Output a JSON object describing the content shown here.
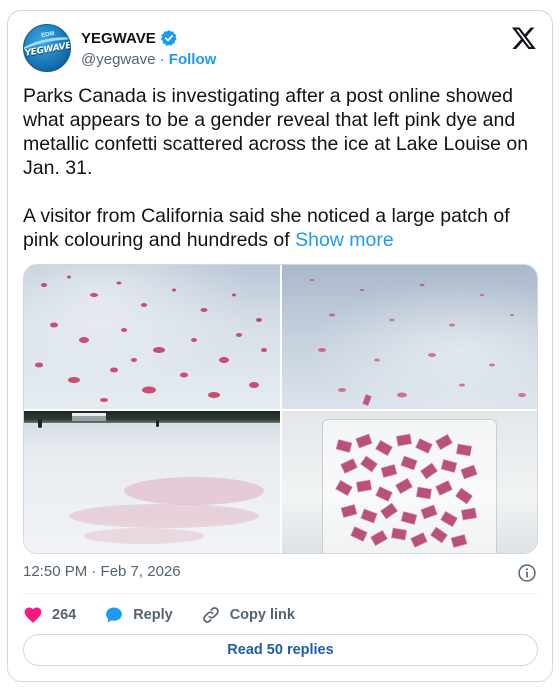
{
  "author": {
    "display_name": "YEGWAVE",
    "handle": "@yegwave",
    "separator": "·",
    "follow_label": "Follow",
    "avatar_logo_text": "YEGWAVE",
    "avatar_logo_sub": "EDM"
  },
  "brand_icon": "x-logo-icon",
  "tweet": {
    "text": "Parks Canada is investigating after a post online showed what appears to be a gender reveal that left pink dye and metallic confetti scattered across the ice at Lake Louise on Jan. 31.\n\nA visitor from California said she noticed a large patch of pink colouring and hundreds of ",
    "show_more_label": "Show more"
  },
  "media": [
    {
      "kind": "photo",
      "subject": "pink dye on snow close-up"
    },
    {
      "kind": "photo",
      "subject": "pink dye scattered on snow"
    },
    {
      "kind": "photo",
      "subject": "frozen lake with pink patch"
    },
    {
      "kind": "photo",
      "subject": "bag of pink metallic confetti"
    }
  ],
  "meta": {
    "timestamp": "12:50 PM · Feb 7, 2026"
  },
  "actions": {
    "like_count": "264",
    "reply_label": "Reply",
    "copy_link_label": "Copy link"
  },
  "read_replies_label": "Read 50 replies",
  "colors": {
    "accent": "#1d9bf0",
    "like": "#f91880",
    "text": "#0f1419",
    "muted": "#536471",
    "border": "#cfd9de",
    "confetti": "#c0577f",
    "dye": "#c21a4a"
  }
}
